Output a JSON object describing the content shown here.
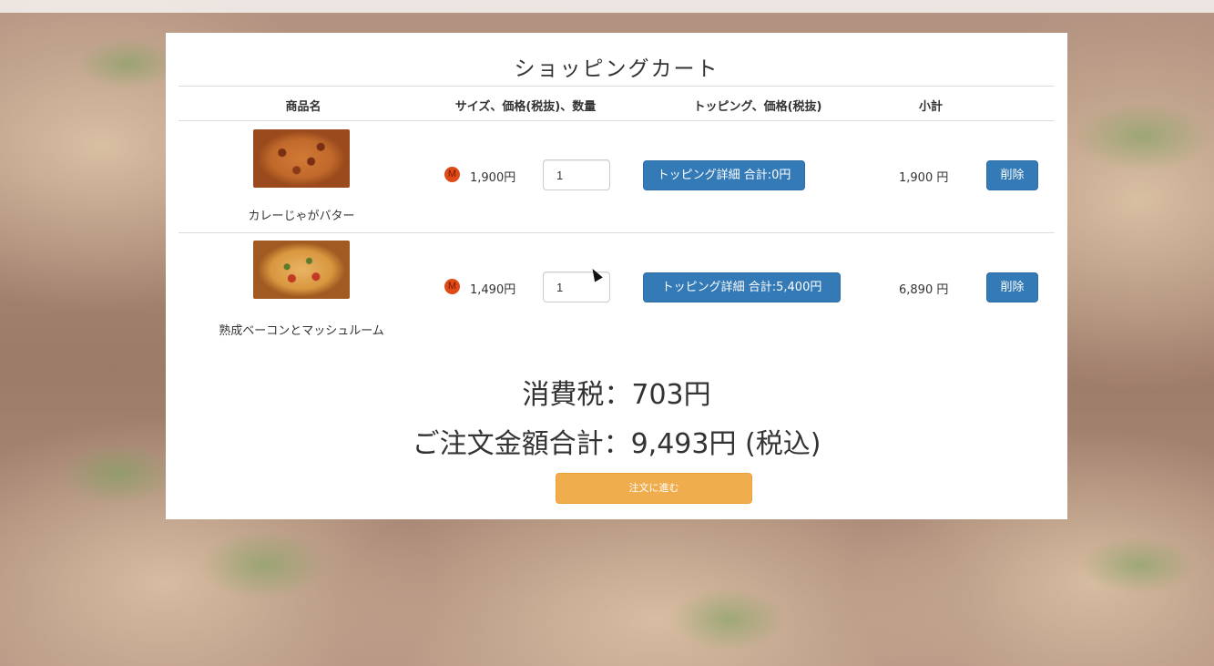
{
  "cart": {
    "title": "ショッピングカート",
    "headers": {
      "item_name": "商品名",
      "size_price_qty": "サイズ、価格(税抜)、数量",
      "topping_price": "トッピング、価格(税抜)",
      "subtotal": "小計"
    },
    "items": [
      {
        "name": "カレーじゃがバター",
        "size": "M",
        "price": "1,900円",
        "quantity": "1",
        "topping_button": "トッピング詳細 合計:0円",
        "subtotal": "1,900 円",
        "delete_label": "削除"
      },
      {
        "name": "熟成ベーコンとマッシュルーム",
        "size": "M",
        "price": "1,490円",
        "quantity": "1",
        "topping_button": "トッピング詳細 合計:5,400円",
        "subtotal": "6,890 円",
        "delete_label": "削除"
      }
    ],
    "tax_line": "消費税：703円",
    "total_line": "ご注文金額合計：9,493円 (税込)",
    "order_button": "注文に進む"
  },
  "colors": {
    "primary": "#337ab7",
    "warning": "#f0ad4e",
    "size_badge": "#e04a17"
  }
}
